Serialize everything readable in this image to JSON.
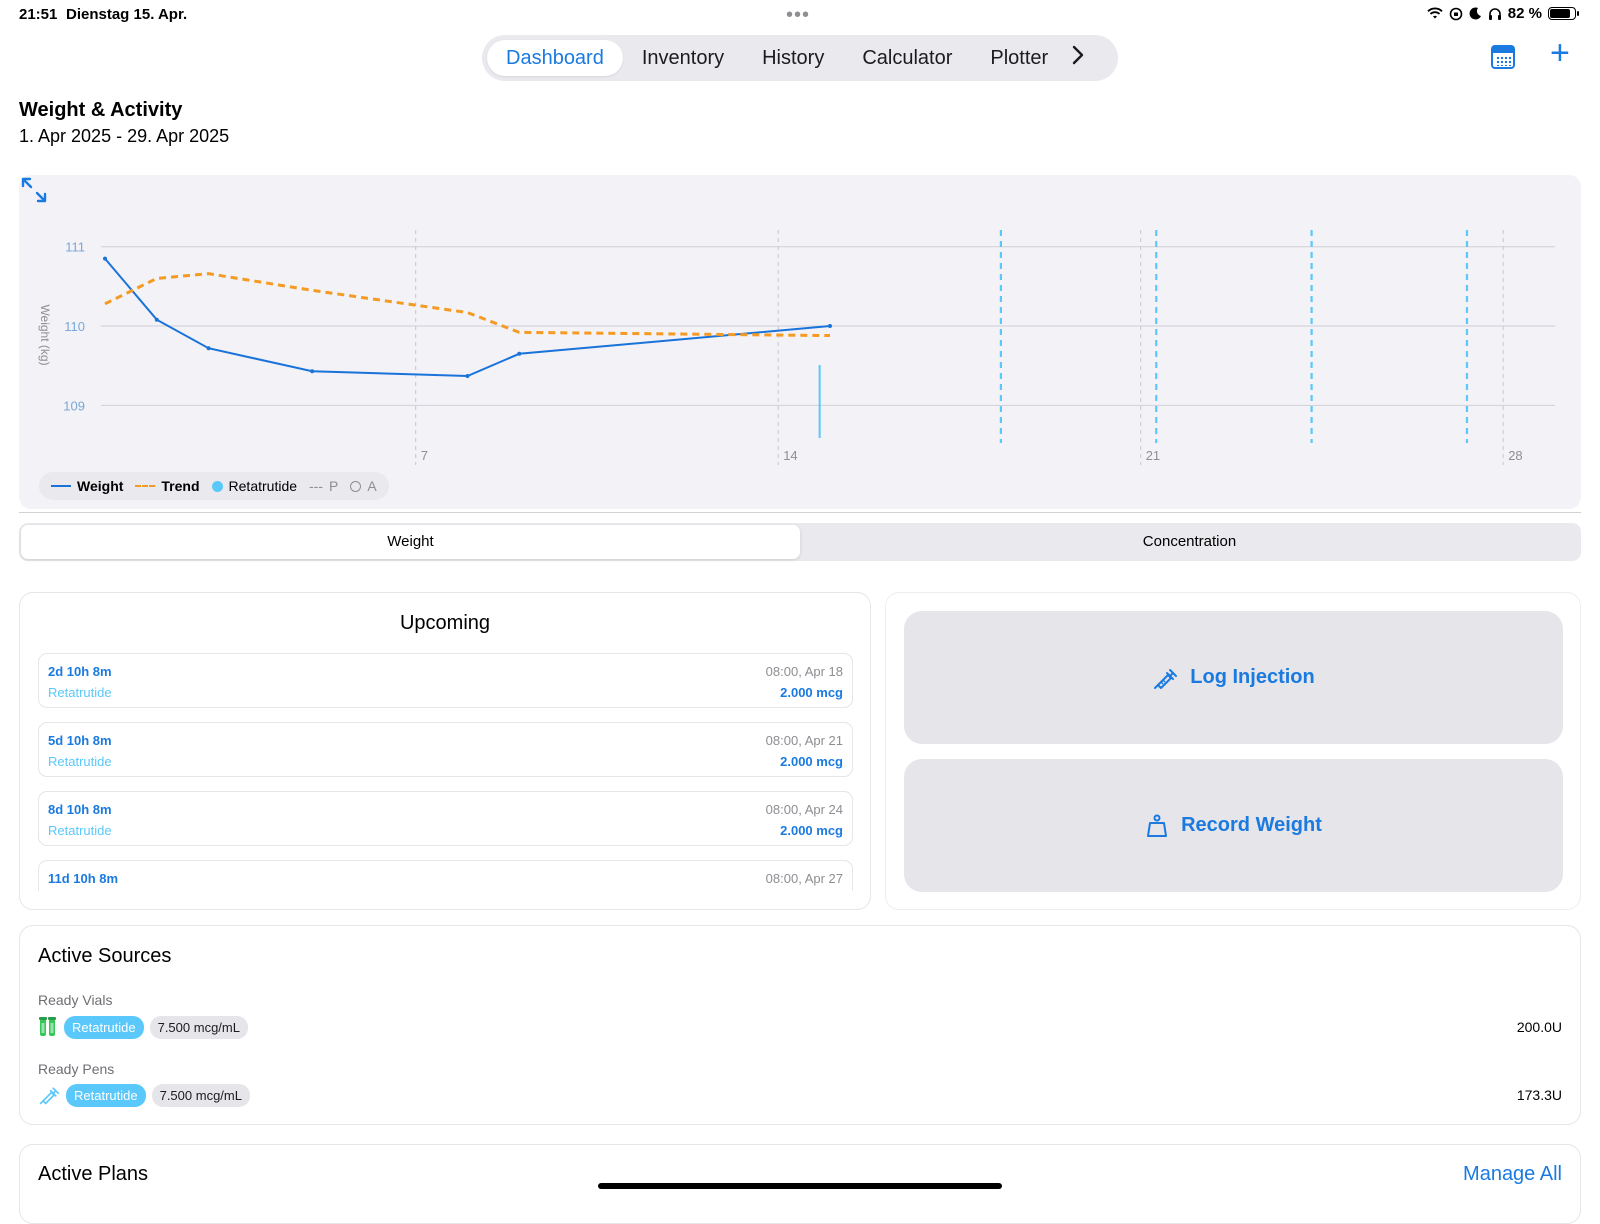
{
  "status_bar": {
    "time": "21:51",
    "date": "Dienstag 15. Apr.",
    "battery": "82 %",
    "battery_level": 0.82
  },
  "nav": {
    "tabs": [
      {
        "label": "Dashboard",
        "active": true
      },
      {
        "label": "Inventory"
      },
      {
        "label": "History"
      },
      {
        "label": "Calculator"
      },
      {
        "label": "Plotter"
      }
    ],
    "more_icon": "chevron-right-icon",
    "calendar_icon": "calendar-icon",
    "add_icon": "plus-icon"
  },
  "header": {
    "title": "Weight & Activity",
    "date_range": "1. Apr 2025 - 29. Apr 2025"
  },
  "chart_data": {
    "type": "line",
    "title": "",
    "ylabel": "Weight (kg)",
    "xlabel": "",
    "xlim": [
      1,
      29
    ],
    "ylim": [
      108.5,
      111.4
    ],
    "x_ticks": [
      7,
      14,
      21,
      28
    ],
    "y_ticks": [
      109,
      110,
      111
    ],
    "grid": true,
    "legend_position": "bottom-left",
    "series": [
      {
        "name": "Weight",
        "color": "#1a73d9",
        "style": "solid",
        "x": [
          1,
          2,
          3,
          5,
          8,
          9,
          15
        ],
        "y": [
          110.85,
          110.08,
          109.72,
          109.43,
          109.37,
          109.65,
          110.0
        ]
      },
      {
        "name": "Trend",
        "color": "#f59a23",
        "style": "dashed",
        "x": [
          1,
          2,
          3,
          5,
          8,
          9,
          15
        ],
        "y": [
          110.28,
          110.6,
          110.66,
          110.45,
          110.17,
          109.92,
          109.88
        ]
      }
    ],
    "events": [
      {
        "name": "Retatrutide",
        "color": "#5ac8fa",
        "style": "solid",
        "x": [
          14.8
        ]
      },
      {
        "name": "Retatrutide",
        "color": "#5ac8fa",
        "style": "dashed",
        "x": [
          18.3,
          21.3,
          24.3,
          27.3
        ]
      }
    ],
    "legend": [
      {
        "label": "Weight",
        "type": "line"
      },
      {
        "label": "Trend",
        "type": "dash"
      },
      {
        "label": "Retatrutide",
        "type": "dot"
      },
      {
        "label": "P",
        "type": "dash-muted",
        "marker": "---"
      },
      {
        "label": "A",
        "type": "ring"
      }
    ]
  },
  "segment": {
    "options": [
      {
        "label": "Weight",
        "active": true
      },
      {
        "label": "Concentration"
      }
    ]
  },
  "upcoming": {
    "title": "Upcoming",
    "items": [
      {
        "countdown": "2d 10h 8m",
        "drug": "Retatrutide",
        "when": "08:00, Apr 18",
        "dose": "2.000 mcg"
      },
      {
        "countdown": "5d 10h 8m",
        "drug": "Retatrutide",
        "when": "08:00, Apr 21",
        "dose": "2.000 mcg"
      },
      {
        "countdown": "8d 10h 8m",
        "drug": "Retatrutide",
        "when": "08:00, Apr 24",
        "dose": "2.000 mcg"
      },
      {
        "countdown": "11d 10h 8m",
        "drug": "",
        "when": "08:00, Apr 27",
        "dose": ""
      }
    ]
  },
  "actions": {
    "log_injection": "Log Injection",
    "record_weight": "Record Weight"
  },
  "active_sources": {
    "title": "Active Sources",
    "vials_label": "Ready Vials",
    "vial": {
      "drug": "Retatrutide",
      "concentration": "7.500 mcg/mL",
      "amount": "200.0U"
    },
    "pens_label": "Ready Pens",
    "pen": {
      "drug": "Retatrutide",
      "concentration": "7.500 mcg/mL",
      "amount": "173.3U"
    }
  },
  "active_plans": {
    "title": "Active Plans",
    "manage": "Manage All"
  }
}
